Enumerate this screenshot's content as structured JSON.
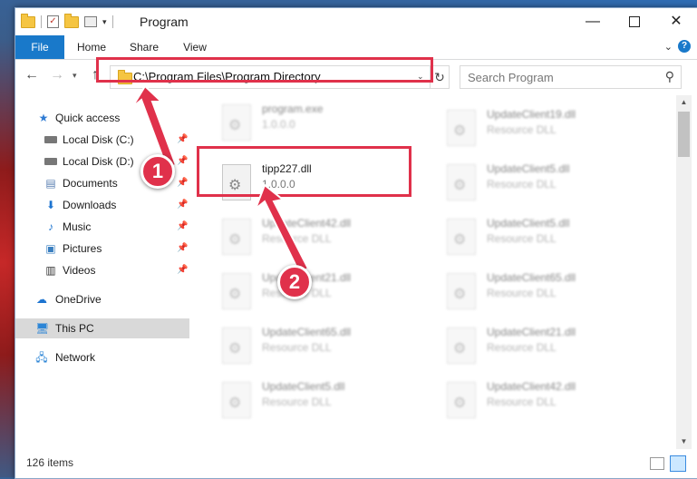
{
  "window": {
    "title": "Program",
    "minimize_glyph": "—",
    "close_glyph": "✕"
  },
  "ribbon": {
    "tabs": [
      {
        "label": "File"
      },
      {
        "label": "Home"
      },
      {
        "label": "Share"
      },
      {
        "label": "View"
      }
    ]
  },
  "address": {
    "path": "C:\\Program Files\\Program Directory"
  },
  "search": {
    "placeholder": "Search Program"
  },
  "sidebar": {
    "quick_access": "Quick access",
    "items": [
      {
        "label": "Local Disk (C:)"
      },
      {
        "label": "Local Disk (D:)"
      },
      {
        "label": "Documents"
      },
      {
        "label": "Downloads"
      },
      {
        "label": "Music"
      },
      {
        "label": "Pictures"
      },
      {
        "label": "Videos"
      }
    ],
    "onedrive": "OneDrive",
    "this_pc": "This PC",
    "network": "Network"
  },
  "files": {
    "col1": [
      {
        "name": "program.exe",
        "sub": "1.0.0.0"
      },
      {
        "name": "tipp227.dll",
        "sub": "1.0.0.0"
      },
      {
        "name": "UpdateClient42.dll",
        "sub": "Resource DLL"
      },
      {
        "name": "UpdateClient21.dll",
        "sub": "Resource DLL"
      },
      {
        "name": "UpdateClient65.dll",
        "sub": "Resource DLL"
      },
      {
        "name": "UpdateClient5.dll",
        "sub": "Resource DLL"
      }
    ],
    "col2": [
      {
        "name": "UpdateClient19.dll",
        "sub": "Resource DLL"
      },
      {
        "name": "UpdateClient5.dll",
        "sub": "Resource DLL"
      },
      {
        "name": "UpdateClient5.dll",
        "sub": "Resource DLL"
      },
      {
        "name": "UpdateClient65.dll",
        "sub": "Resource DLL"
      },
      {
        "name": "UpdateClient21.dll",
        "sub": "Resource DLL"
      },
      {
        "name": "UpdateClient42.dll",
        "sub": "Resource DLL"
      }
    ]
  },
  "status": {
    "item_count": "126 items"
  },
  "annotations": {
    "step1": "1",
    "step2": "2",
    "color": "#e0314b"
  },
  "colors": {
    "accent": "#1979ca",
    "selection": "#cce8ff"
  }
}
